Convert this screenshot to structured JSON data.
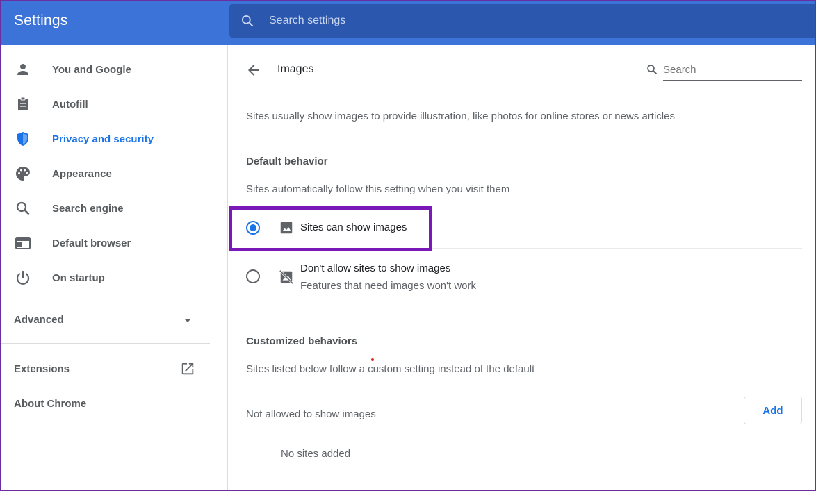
{
  "header": {
    "app_title": "Settings",
    "search_placeholder": "Search settings"
  },
  "sidebar": {
    "items": [
      {
        "label": "You and Google",
        "icon": "person-icon"
      },
      {
        "label": "Autofill",
        "icon": "clipboard-icon"
      },
      {
        "label": "Privacy and security",
        "icon": "shield-icon",
        "active": true
      },
      {
        "label": "Appearance",
        "icon": "palette-icon"
      },
      {
        "label": "Search engine",
        "icon": "search-icon"
      },
      {
        "label": "Default browser",
        "icon": "browser-icon"
      },
      {
        "label": "On startup",
        "icon": "power-icon"
      }
    ],
    "advanced_label": "Advanced",
    "extensions_label": "Extensions",
    "about_label": "About Chrome"
  },
  "main": {
    "page_title": "Images",
    "search_placeholder": "Search",
    "description": "Sites usually show images to provide illustration, like photos for online stores or news articles",
    "default_behavior": {
      "heading": "Default behavior",
      "subtitle": "Sites automatically follow this setting when you visit them",
      "options": [
        {
          "label": "Sites can show images",
          "sublabel": "",
          "checked": true,
          "icon": "image-icon"
        },
        {
          "label": "Don't allow sites to show images",
          "sublabel": "Features that need images won't work",
          "checked": false,
          "icon": "image-off-icon"
        }
      ]
    },
    "customized_behaviors": {
      "heading": "Customized behaviors",
      "subtitle": "Sites listed below follow a custom setting instead of the default",
      "not_allowed_label": "Not allowed to show images",
      "add_label": "Add",
      "empty_label": "No sites added"
    }
  },
  "colors": {
    "header_bg": "#3c73d8",
    "search_bg": "#2c57ae",
    "accent": "#1a73e8",
    "highlight": "#7b19b8"
  }
}
